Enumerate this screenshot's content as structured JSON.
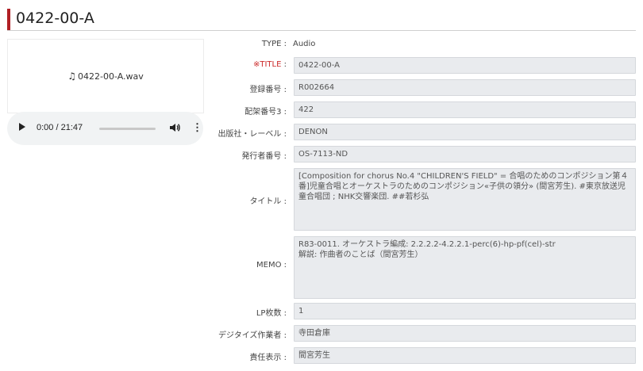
{
  "page": {
    "title": "0422-00-A"
  },
  "media": {
    "file_icon": "music-note-icon",
    "file_name": "0422-00-A.wav",
    "time": "0:00 / 21:47"
  },
  "fields": [
    {
      "label": "TYPE :",
      "value": "Audio"
    },
    {
      "label_req": "※TITLE",
      "label": " :",
      "value": "0422-00-A"
    },
    {
      "label": "登録番号 :",
      "value": "R002664"
    },
    {
      "label": "配架番号3 :",
      "value": "422"
    },
    {
      "label": "出版社・レーベル :",
      "value": "DENON"
    },
    {
      "label": "発行者番号 :",
      "value": "OS-7113-ND"
    },
    {
      "label": "タイトル :",
      "value": "[Composition for chorus No.4 \"CHILDREN'S FIELD\" = 合唱のためのコンポジション第４番]児童合唱とオーケストラのためのコンポジション«子供の領分» (間宮芳生). #東京放送児童合唱団 ; NHK交響楽団. ##若杉弘"
    },
    {
      "label": "MEMO :",
      "value": "R83-0011. オーケストラ編成: 2.2.2.2-4.2.2.1-perc(6)-hp-pf(cel)-str\n解説: 作曲者のことば（間宮芳生）"
    },
    {
      "label": "LP枚数 :",
      "value": "1"
    },
    {
      "label": "デジタイズ作業者 :",
      "value": "寺田倉庫"
    },
    {
      "label": "責任表示 :",
      "value": "間宮芳生"
    }
  ],
  "colors": {
    "accent": "#b01f24",
    "required": "#cc2a2a",
    "field_bg": "#e9ebee"
  }
}
